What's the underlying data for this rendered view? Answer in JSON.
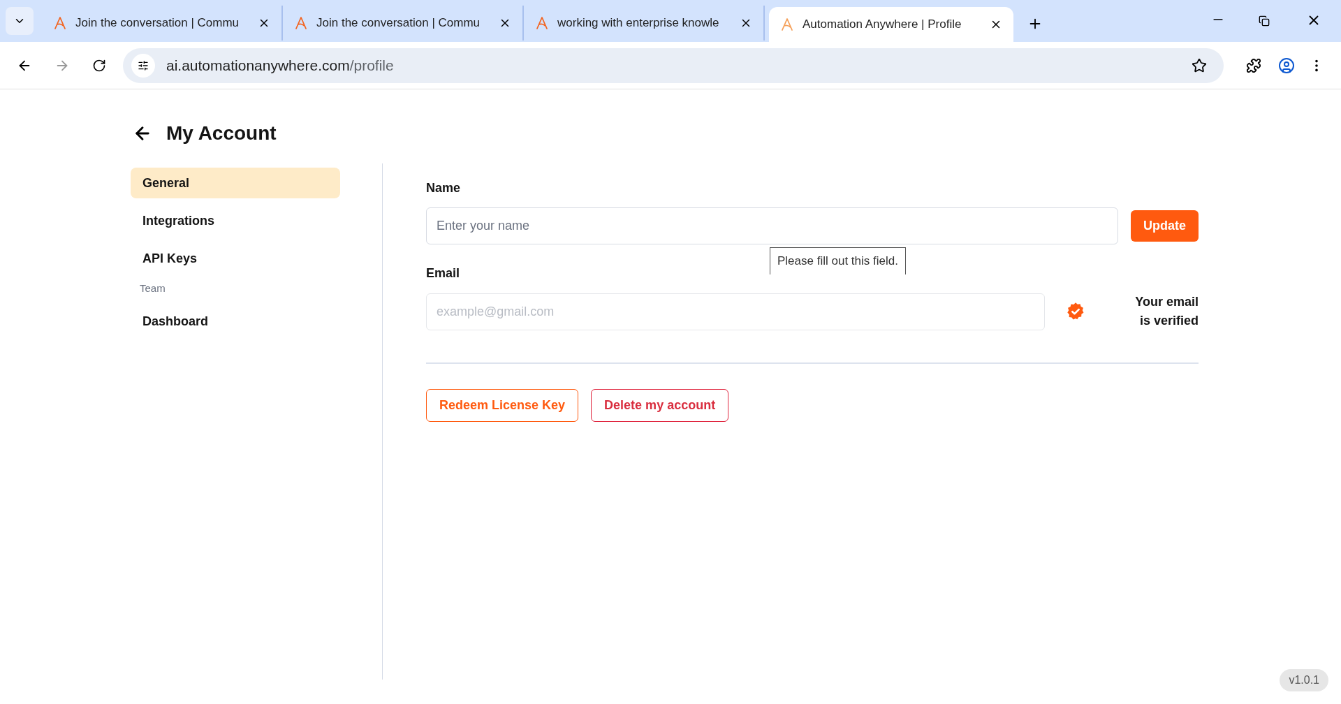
{
  "browser": {
    "tabs": [
      {
        "title": "Join the conversation | Commu",
        "selected": false
      },
      {
        "title": "Join the conversation | Commu",
        "selected": false
      },
      {
        "title": "working with enterprise knowle",
        "selected": false
      },
      {
        "title": "Automation Anywhere | Profile",
        "selected": true
      }
    ],
    "url_host": "ai.automationanywhere.com",
    "url_path": "/profile"
  },
  "page": {
    "title": "My Account",
    "sidebar": [
      {
        "kind": "item",
        "label": "General",
        "selected": true
      },
      {
        "kind": "item",
        "label": "Integrations",
        "selected": false
      },
      {
        "kind": "item",
        "label": "API Keys",
        "selected": false
      },
      {
        "kind": "heading",
        "label": "Team"
      },
      {
        "kind": "item",
        "label": "Dashboard",
        "selected": false
      }
    ],
    "name": {
      "label": "Name",
      "placeholder": "Enter your name",
      "button": "Update",
      "tooltip": "Please fill out this field."
    },
    "email": {
      "label": "Email",
      "placeholder": "example@gmail.com",
      "verified_text": "Your email is verified"
    },
    "buttons": [
      {
        "kind": "orange",
        "label": "Redeem License Key"
      },
      {
        "kind": "red",
        "label": "Delete my account"
      }
    ],
    "version": "v1.0.1"
  }
}
